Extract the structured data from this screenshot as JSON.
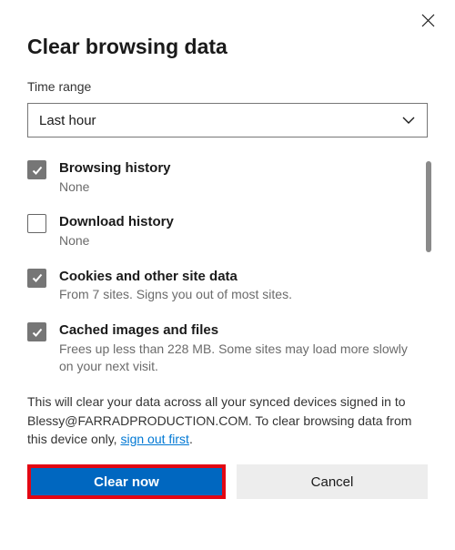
{
  "dialog": {
    "title": "Clear browsing data",
    "time_range_label": "Time range",
    "time_range_value": "Last hour"
  },
  "options": {
    "browsing_history": {
      "title": "Browsing history",
      "sub": "None",
      "checked": true
    },
    "download_history": {
      "title": "Download history",
      "sub": "None",
      "checked": false
    },
    "cookies": {
      "title": "Cookies and other site data",
      "sub": "From 7 sites. Signs you out of most sites.",
      "checked": true
    },
    "cache": {
      "title": "Cached images and files",
      "sub": "Frees up less than 228 MB. Some sites may load more slowly on your next visit.",
      "checked": true
    }
  },
  "disclaimer": {
    "text_a": "This will clear your data across all your synced devices signed in to Blessy@FARRADPRODUCTION.COM. To clear browsing data from this device only, ",
    "link": "sign out first",
    "text_b": "."
  },
  "buttons": {
    "clear": "Clear now",
    "cancel": "Cancel"
  }
}
